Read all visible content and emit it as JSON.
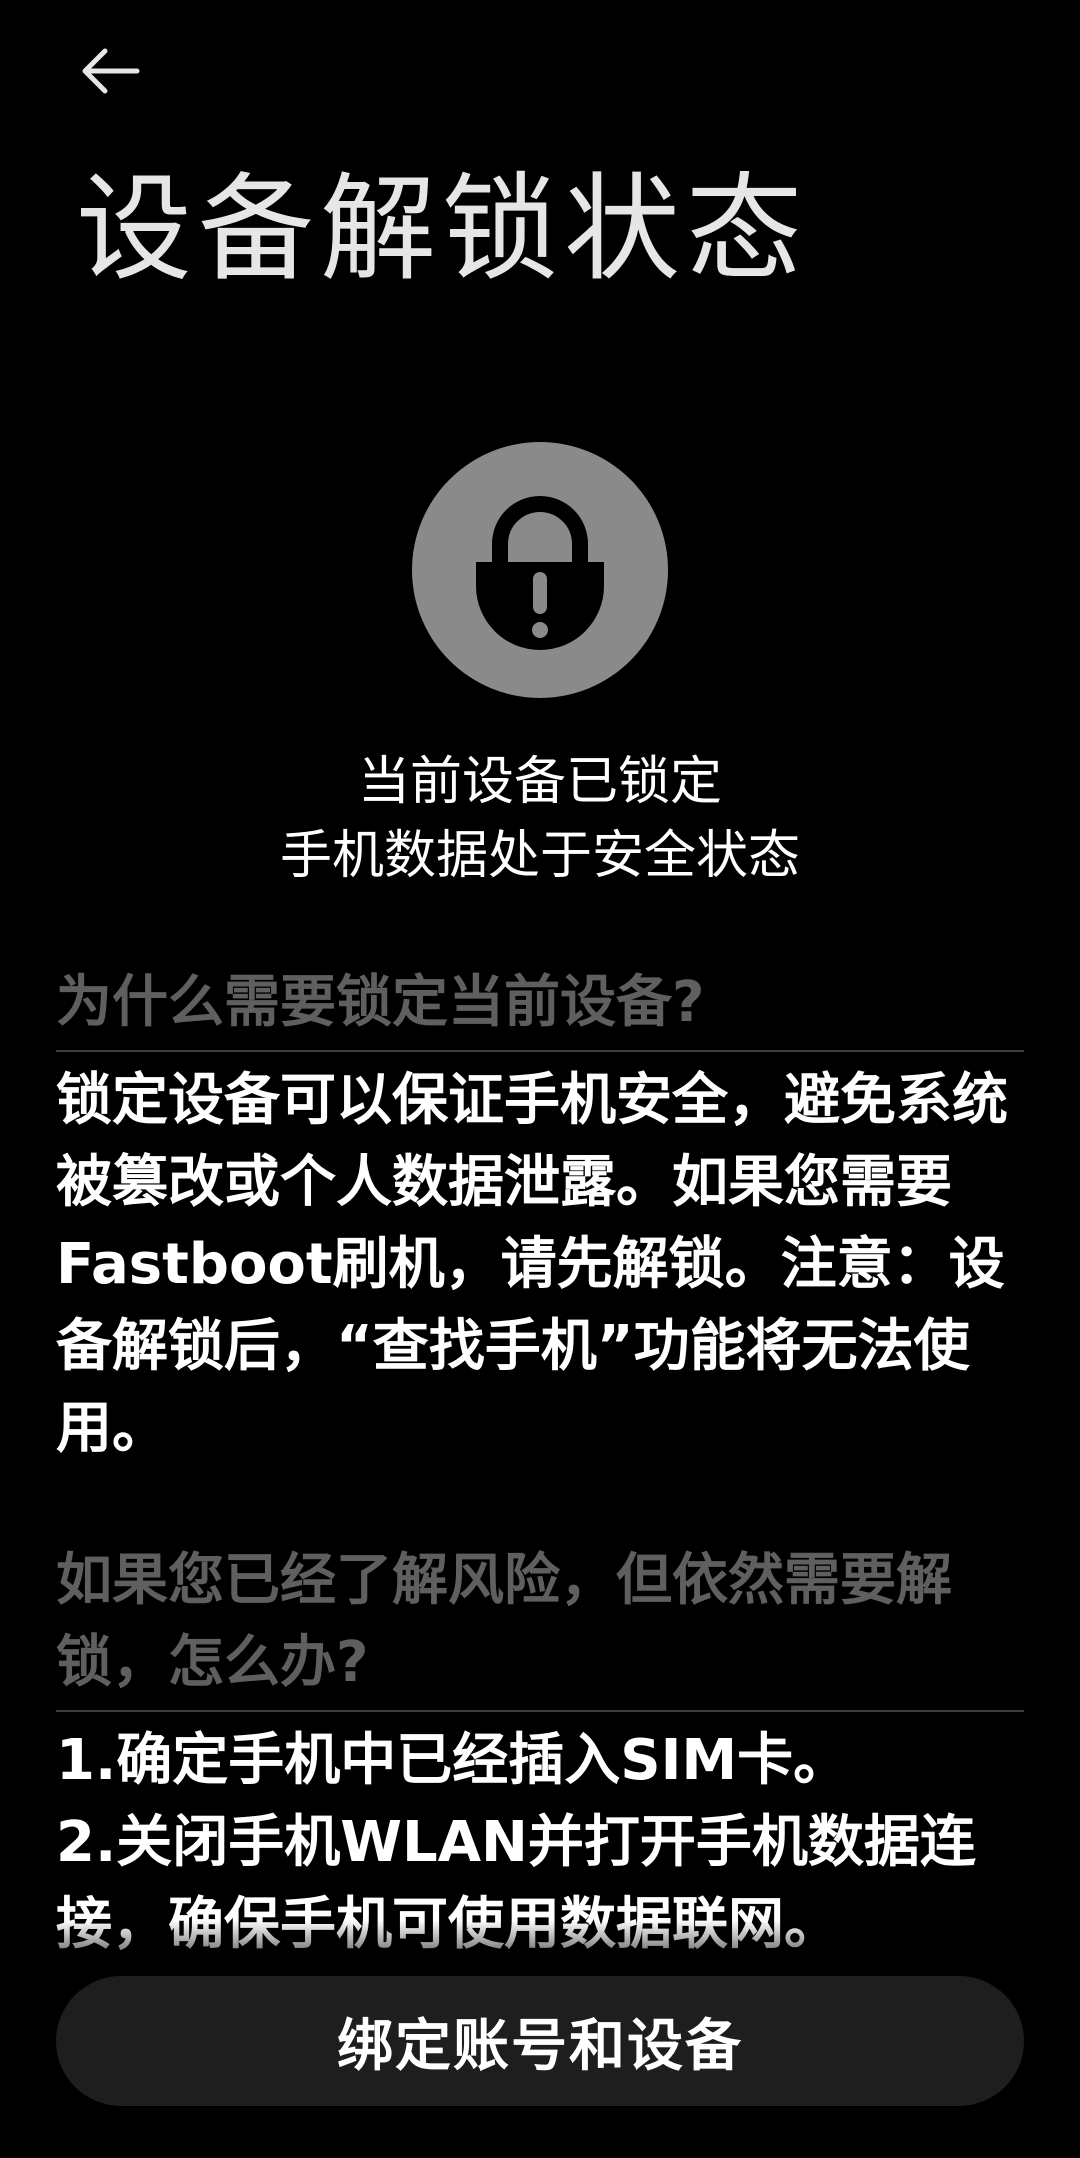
{
  "header": {
    "back_icon": "arrow-left-icon",
    "title": "设备解锁状态"
  },
  "status": {
    "icon": "lock-warning-icon",
    "icon_circle_color": "#8a8a8a",
    "line1": "当前设备已锁定",
    "line2": "手机数据处于安全状态"
  },
  "sections": [
    {
      "heading": "为什么需要锁定当前设备?",
      "body": "锁定设备可以保证手机安全，避免系统被篡改或个人数据泄露。如果您需要Fastboot刷机，请先解锁。注意：设备解锁后，“查找手机”功能将无法使用。"
    },
    {
      "heading": "如果您已经了解风险，但依然需要解锁，怎么办?",
      "body": "1.确定手机中已经插入SIM卡。\n2.关闭手机WLAN并打开手机数据连接，确保手机可使用数据联网。"
    }
  ],
  "footer": {
    "bind_button_label": "绑定账号和设备"
  }
}
